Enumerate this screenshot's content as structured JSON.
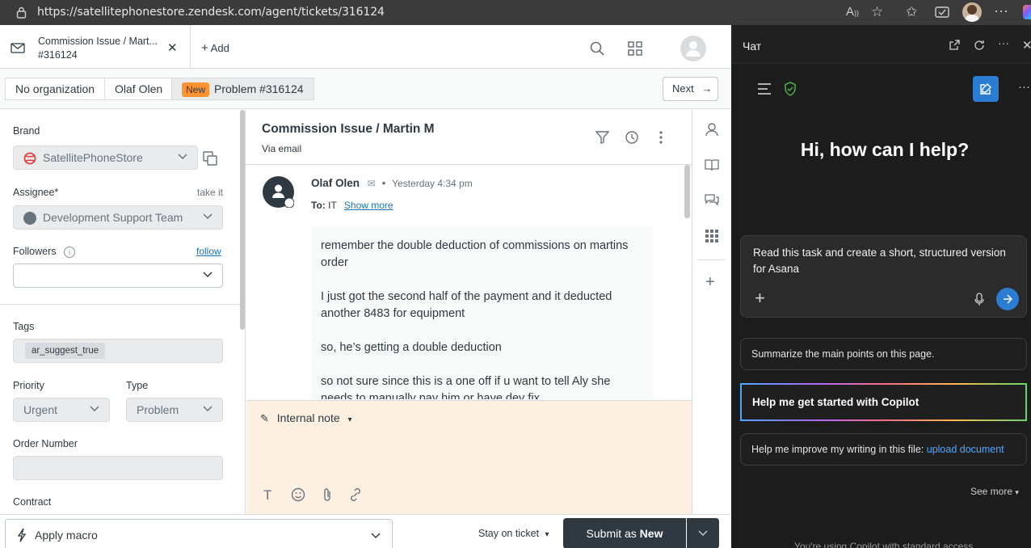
{
  "browser": {
    "url": "https://satellitephonestore.zendesk.com/agent/tickets/316124"
  },
  "header": {
    "tab_title_line1": "Commission Issue / Mart...",
    "tab_title_line2": "#316124",
    "add_label": "Add"
  },
  "breadcrumbs": {
    "organization": "No organization",
    "requester": "Olaf Olen",
    "status_badge": "New",
    "ticket": "Problem #316124",
    "next_label": "Next"
  },
  "properties": {
    "brand_label": "Brand",
    "brand_value": "SatellitePhoneStore",
    "assignee_label": "Assignee*",
    "take_it": "take it",
    "assignee_value": "Development Support Team",
    "followers_label": "Followers",
    "follow_link": "follow",
    "tags_label": "Tags",
    "tags": [
      "ar_suggest_true"
    ],
    "priority_label": "Priority",
    "priority_value": "Urgent",
    "type_label": "Type",
    "type_value": "Problem",
    "order_number_label": "Order Number",
    "contract_label": "Contract"
  },
  "conversation": {
    "subject": "Commission Issue / Martin M",
    "channel": "Via email",
    "message": {
      "author": "Olaf Olen",
      "time": "Yesterday 4:34 pm",
      "to_label": "To:",
      "to_value": "IT",
      "show_more": "Show more",
      "paragraphs": [
        "remember the double deduction of commissions on martins order",
        "I just got the second half of the payment and it deducted another 8483 for equipment",
        "so, he’s getting a double deduction",
        "so not sure since this is a one off if u want to tell Aly she needs to manually pay him or have dev fix"
      ]
    },
    "reply_mode": "Internal note"
  },
  "bottom": {
    "macro_label": "Apply macro",
    "stay_label": "Stay on ticket",
    "submit_prefix": "Submit as",
    "submit_status": "New"
  },
  "copilot": {
    "panel_title": "Чат",
    "greeting": "Hi, how can I help?",
    "prompt_text": "Read this task and create a short, structured version for Asana",
    "suggestion_1": "Summarize the main points on this page.",
    "suggestion_2": "Help me get started with Copilot",
    "suggestion_3_text": "Help me improve my writing in this file:",
    "suggestion_3_link": "upload document",
    "see_more": "See more",
    "footer_partial": "You're using Copilot with standard access"
  },
  "colors": {
    "zendesk_dark": "#2f3941",
    "new_badge": "#ff9231",
    "reply_bg": "#fdf0e1",
    "copilot_bg": "#1c1c1c",
    "copilot_accent": "#2b7cd3",
    "brand_icon_red": "#e0413d"
  }
}
